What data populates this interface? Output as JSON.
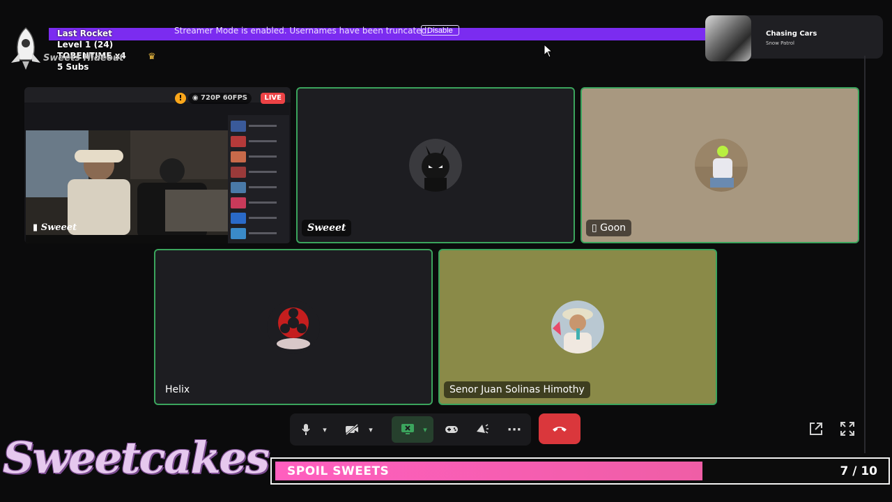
{
  "banner": {
    "text": "Streamer Mode is enabled. Usernames have been truncated.",
    "button": "Disable"
  },
  "rocket_overlay": {
    "title": "Last Rocket",
    "level": "Level 1  (24)",
    "user": "TOBENTIME x4",
    "subs": "5 Subs"
  },
  "server": {
    "name": "Sweets Hideout"
  },
  "now_playing": {
    "title": "Chasing Cars",
    "artist": "Snow Patrol"
  },
  "tiles": [
    {
      "name": "Sweeet",
      "badge_quality": "720P 60FPS",
      "badge_live": "LIVE",
      "icon": "eye-icon"
    },
    {
      "name": "Sweeet"
    },
    {
      "name": "Goon",
      "icon": "mobile-phone-icon"
    },
    {
      "name": "Helix"
    },
    {
      "name": "Senor Juan Solinas Himothy"
    }
  ],
  "colors": {
    "speaking": "#3ba55d",
    "banner": "#7b2cf0",
    "hangup": "#da373c",
    "goal_fill": "#ff5fbf",
    "live": "#ed4245"
  },
  "branding": {
    "text": "Sweetcakes"
  },
  "goal": {
    "label": "SPOIL SWEETS",
    "current": 7,
    "target": 10,
    "count_text": "7 / 10"
  }
}
